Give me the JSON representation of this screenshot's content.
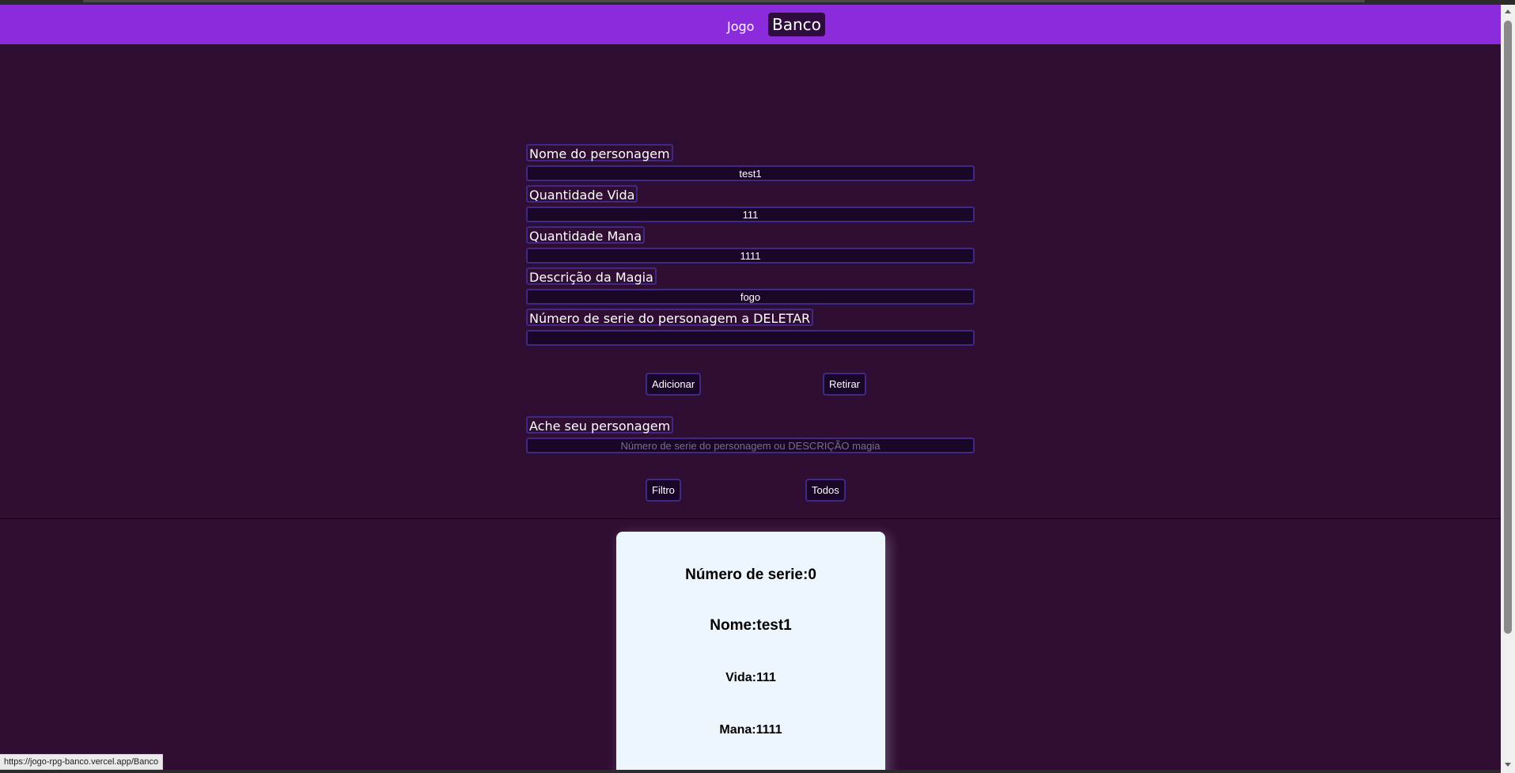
{
  "nav": {
    "jogo": "Jogo",
    "banco": "Banco"
  },
  "form": {
    "nome_label": "Nome do personagem",
    "nome_value": "test1",
    "vida_label": "Quantidade Vida",
    "vida_value": "111",
    "mana_label": "Quantidade Mana",
    "mana_value": "1111",
    "magia_label": "Descrição da Magia",
    "magia_value": "fogo",
    "deletar_label": "Número de serie do personagem a DELETAR",
    "deletar_value": "",
    "adicionar": "Adicionar",
    "retirar": "Retirar"
  },
  "search": {
    "label": "Ache seu personagem",
    "placeholder": "Número de serie do personagem ou DESCRIÇÃO magia",
    "filtro": "Filtro",
    "todos": "Todos"
  },
  "card": {
    "serie": "Número de serie:0",
    "nome": "Nome:test1",
    "vida": "Vida:111",
    "mana": "Mana:1111"
  },
  "status": {
    "url": "https://jogo-rpg-banco.vercel.app/Banco"
  }
}
